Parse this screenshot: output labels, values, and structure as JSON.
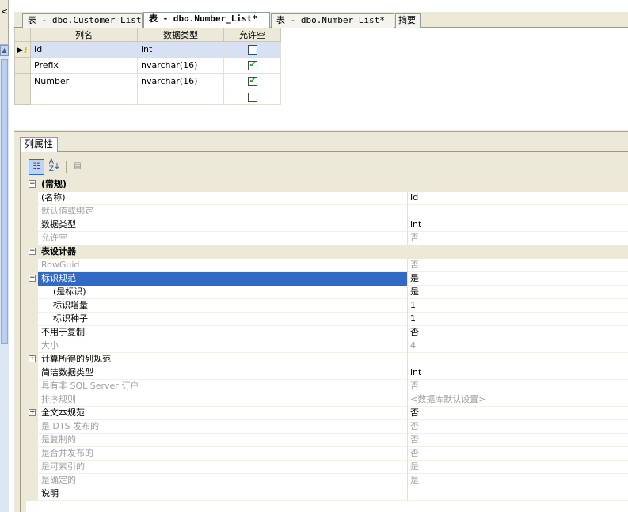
{
  "tabs": [
    {
      "label": "表 - dbo.Customer_List",
      "active": false
    },
    {
      "label": "表 - dbo.Number_List*",
      "active": true
    },
    {
      "label": "表 - dbo.Number_List*",
      "active": false
    },
    {
      "label": "摘要",
      "active": false
    }
  ],
  "columns_grid": {
    "headers": [
      "列名",
      "数据类型",
      "允许空"
    ],
    "rows": [
      {
        "name": "Id",
        "type": "int",
        "nullable": false,
        "primary_key": true,
        "current": true
      },
      {
        "name": "Prefix",
        "type": "nvarchar(16)",
        "nullable": true
      },
      {
        "name": "Number",
        "type": "nvarchar(16)",
        "nullable": true
      },
      {
        "name": "",
        "type": "",
        "nullable": false
      }
    ]
  },
  "properties_tab": "列属性",
  "properties": [
    {
      "type": "cat",
      "label": "(常规)",
      "expander": "⊟"
    },
    {
      "label": "(名称)",
      "value": "Id"
    },
    {
      "label": "默认值或绑定",
      "value": "",
      "dim": true
    },
    {
      "label": "数据类型",
      "value": "int"
    },
    {
      "label": "允许空",
      "value": "否",
      "dim": true
    },
    {
      "type": "cat",
      "label": "表设计器",
      "expander": "⊟"
    },
    {
      "label": "RowGuid",
      "value": "否",
      "dim": true
    },
    {
      "label": "标识规范",
      "value": "是",
      "selected": true,
      "expander": "⊟"
    },
    {
      "label": "(是标识)",
      "value": "是",
      "child": true
    },
    {
      "label": "标识增量",
      "value": "1",
      "child": true
    },
    {
      "label": "标识种子",
      "value": "1",
      "child": true
    },
    {
      "label": "不用于复制",
      "value": "否"
    },
    {
      "label": "大小",
      "value": "4",
      "dim": true
    },
    {
      "label": "计算所得的列规范",
      "value": "",
      "expander": "⊞"
    },
    {
      "label": "简洁数据类型",
      "value": "int"
    },
    {
      "label": "具有非 SQL Server 订户",
      "value": "否",
      "dim": true
    },
    {
      "label": "排序规则",
      "value": "<数据库默认设置>",
      "dim": true
    },
    {
      "label": "全文本规范",
      "value": "否",
      "expander": "⊞"
    },
    {
      "label": "是 DTS 发布的",
      "value": "否",
      "dim": true
    },
    {
      "label": "是复制的",
      "value": "否",
      "dim": true
    },
    {
      "label": "是合并发布的",
      "value": "否",
      "dim": true
    },
    {
      "label": "是可索引的",
      "value": "是",
      "dim": true
    },
    {
      "label": "是确定的",
      "value": "是",
      "dim": true
    },
    {
      "label": "说明",
      "value": ""
    }
  ],
  "toolbar": {
    "categorized_icon": "categorized-icon",
    "alphabetical_icon": "alphabetical-icon",
    "property_pages_icon": "property-pages-icon"
  }
}
